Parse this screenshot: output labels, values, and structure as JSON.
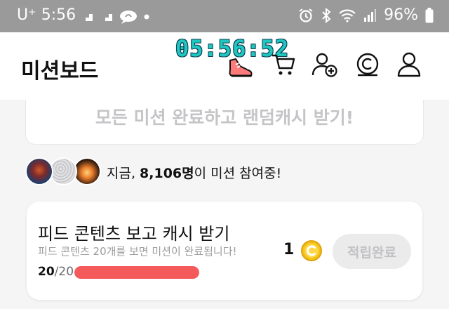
{
  "status_bar": {
    "carrier": "U⁺",
    "time": "5:56",
    "battery": "96%"
  },
  "header": {
    "title": "미션보드",
    "timer": "05:56:52"
  },
  "all_missions_banner": "모든 미션 완료하고 랜덤캐시 받기!",
  "participants": {
    "prefix": "지금, ",
    "count": "8,106명",
    "suffix": "이 미션 참여중!"
  },
  "mission": {
    "title": "피드 콘텐츠 보고 캐시 받기",
    "description": "피드 콘텐츠 20개를 보면 미션이 완료됩니다!",
    "reward": "1",
    "button_label": "적립완료",
    "progress_current": "20",
    "progress_total": "/20",
    "progress_fraction": 1.0
  },
  "colors": {
    "accent_teal": "#1fc7c1",
    "progress_red": "#f55a5a",
    "coin_yellow": "#f4c21b"
  }
}
